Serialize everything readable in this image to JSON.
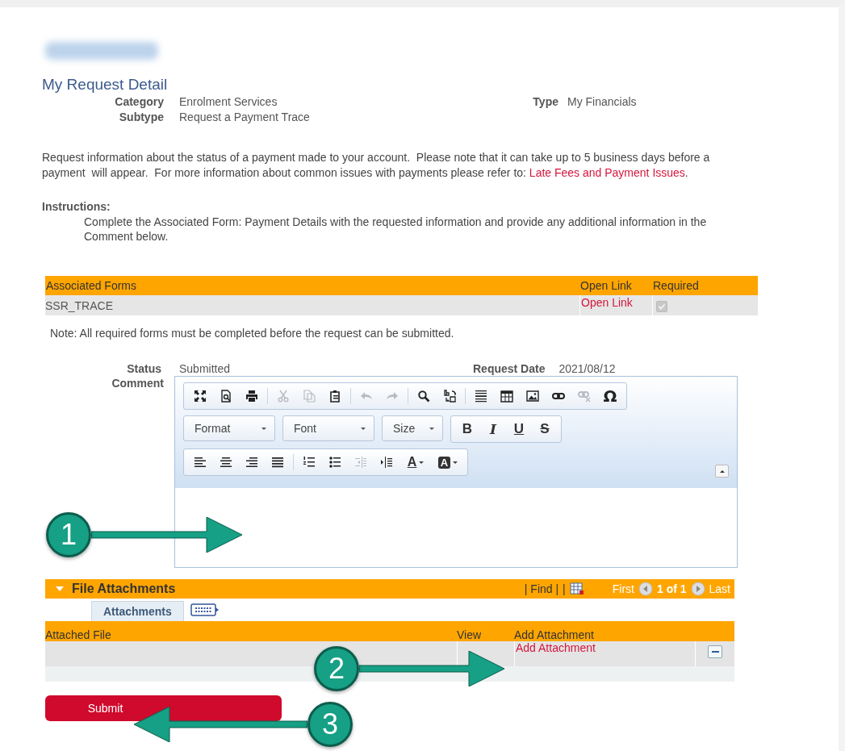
{
  "page_title": "My Request Detail",
  "fields": [
    [
      {
        "label": "Category",
        "value": "Enrolment Services"
      },
      {
        "label": "Type",
        "value": "My Financials"
      }
    ],
    [
      {
        "label": "Subtype",
        "value": "Request a Payment Trace"
      }
    ]
  ],
  "description": {
    "text": "Request information about the status of a payment made to your account.  Please note that it can take up to 5 business days before a payment  will appear.  For more information about common issues with payments please refer to: ",
    "link": "Late Fees and Payment Issues",
    "end": "."
  },
  "instructions": {
    "heading": "Instructions:",
    "text": "Complete the Associated Form: Payment Details with the requested information and provide any additional information in the Comment below."
  },
  "forms_table": {
    "columns": [
      "Associated Forms",
      "Open Link",
      "Required"
    ],
    "rows": [
      {
        "form": "SSR_TRACE",
        "link": "Open Link",
        "required": true,
        "disabled": true
      }
    ]
  },
  "note": "Note: All required forms must be completed before the request can be submitted.",
  "status": [
    {
      "label": "Status",
      "value": "Submitted"
    },
    {
      "label": "Request Date",
      "value": "2021/08/12"
    }
  ],
  "comment_label": "Comment",
  "editor": {
    "toolbar_1": [
      [
        {
          "kind": "icon",
          "disabled": false
        },
        {
          "kind": "icon",
          "disabled": false
        },
        {
          "kind": "icon",
          "disabled": false
        }
      ],
      [
        {
          "kind": "icon",
          "disabled": true
        },
        {
          "kind": "icon",
          "disabled": true
        },
        {
          "kind": "icon",
          "disabled": false
        }
      ],
      [
        {
          "kind": "icon",
          "disabled": true
        },
        {
          "kind": "icon",
          "disabled": true
        }
      ],
      [
        {
          "kind": "icon",
          "disabled": false
        },
        {
          "kind": "icon",
          "disabled": false
        }
      ],
      [
        {
          "kind": "icon",
          "disabled": false
        },
        {
          "kind": "icon",
          "disabled": false
        },
        {
          "kind": "icon",
          "disabled": false
        },
        {
          "kind": "icon",
          "disabled": false
        },
        {
          "kind": "icon",
          "disabled": true
        },
        {
          "kind": "char",
          "label": "Ω",
          "disabled": false
        }
      ]
    ],
    "dropdowns": [
      "Format",
      "Font",
      "Size"
    ],
    "styles": [
      "B",
      "I",
      "U",
      "S"
    ],
    "toolbar_3": [
      [
        {
          "kind": "icon",
          "disabled": false
        },
        {
          "kind": "icon",
          "disabled": false
        },
        {
          "kind": "icon",
          "disabled": false
        },
        {
          "kind": "icon",
          "disabled": false
        }
      ],
      [
        {
          "kind": "icon",
          "disabled": false
        },
        {
          "kind": "icon",
          "disabled": false
        },
        {
          "kind": "icon",
          "disabled": true
        },
        {
          "kind": "icon",
          "disabled": false
        },
        {
          "kind": "text-color",
          "label": "A",
          "disabled": false
        },
        {
          "kind": "back-color",
          "label": "A",
          "disabled": false
        }
      ]
    ]
  },
  "attachments": {
    "title": "File Attachments",
    "expanded": true,
    "find": "| Find |",
    "separator": "|",
    "first": "First",
    "count": "1 of 1",
    "last": "Last",
    "tabs": [
      {
        "label": "Attachments",
        "selected": true
      }
    ],
    "columns": [
      "Attached File",
      "View",
      "Add Attachment"
    ],
    "rows": [
      {
        "link": "Add Attachment"
      }
    ]
  },
  "buttons": [
    {
      "kind": "labeled",
      "label": "Submit"
    },
    {
      "kind": "covered"
    }
  ],
  "callouts": [
    {
      "number": "1",
      "kind": "arrow-right"
    },
    {
      "number": "2",
      "kind": "arrow-right"
    },
    {
      "number": "3",
      "kind": "arrow-left"
    }
  ]
}
